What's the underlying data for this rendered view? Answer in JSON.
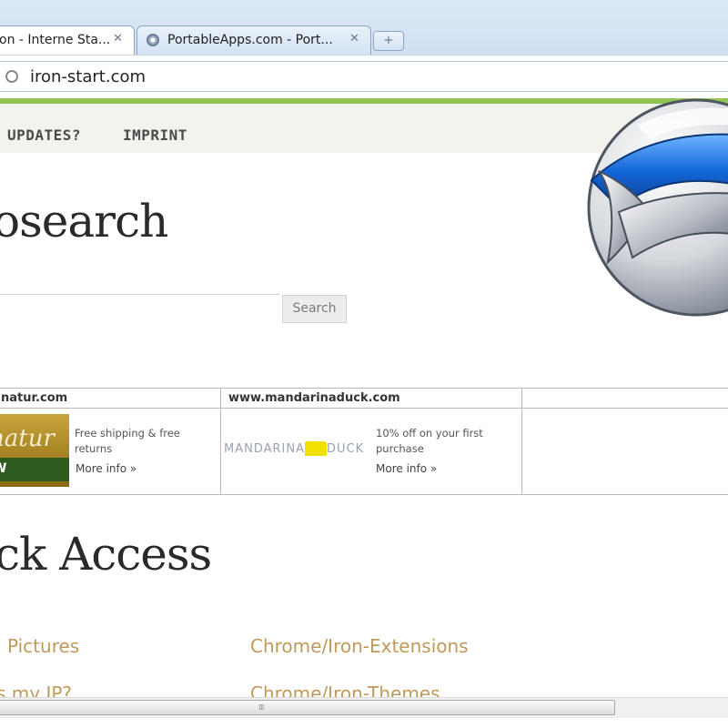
{
  "browser": {
    "tabs": [
      {
        "title": "on - Interne Sta...",
        "active": true
      },
      {
        "title": "PortableApps.com - Port...",
        "active": false
      }
    ],
    "close_glyph": "✕",
    "new_tab_glyph": "+",
    "address": "iron-start.com",
    "accent_color": "#8fc552"
  },
  "nav": {
    "items": [
      "UPDATES?",
      "IMPRINT"
    ]
  },
  "search": {
    "heading": "osearch",
    "input_value": "",
    "button_label": "Search"
  },
  "ads": [
    {
      "site": "natur.com",
      "logo_text": "natur",
      "logo_bar_text": "W",
      "text": "Free shipping & free returns",
      "more": "More info »"
    },
    {
      "site": "www.mandarinaduck.com",
      "logo_text_left": "MANDARINA",
      "logo_text_hl": "",
      "logo_text_right": "DUCK",
      "text": "10% off on your first purchase",
      "more": "More info »"
    },
    {
      "site": "",
      "text": "",
      "more": ""
    }
  ],
  "quick_access": {
    "heading": "ck Access",
    "links": [
      "Pictures",
      "Chrome/Iron-Extensions",
      "s my IP?",
      "Chrome/Iron-Themes"
    ],
    "link_color": "#c09a5a"
  },
  "scrollbar": {
    "grip": "⁞⁞⁞"
  },
  "icons": [
    "globe-icon",
    "close-icon",
    "new-tab-icon",
    "page-icon",
    "play-icon",
    "iron-logo-icon"
  ]
}
